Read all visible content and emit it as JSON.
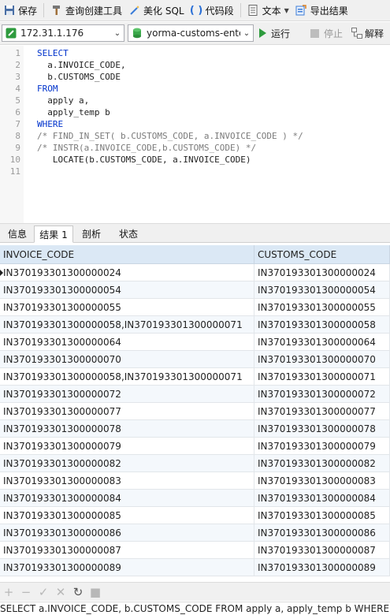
{
  "toolbar": {
    "save": "保存",
    "query_builder": "查询创建工具",
    "beautify": "美化 SQL",
    "snippet": "代码段",
    "text": "文本",
    "export": "导出结果"
  },
  "connection": {
    "host": "172.31.1.176",
    "database": "yorma-customs-ente",
    "run": "运行",
    "stop": "停止",
    "explain": "解释"
  },
  "editor": {
    "line_numbers": [
      "1",
      "2",
      "3",
      "4",
      "5",
      "6",
      "7",
      "8",
      "9",
      "10",
      "11"
    ],
    "lines": [
      "SELECT",
      "  a.INVOICE_CODE,",
      "  b.CUSTOMS_CODE",
      "FROM",
      "  apply a,",
      "  apply_temp b",
      "WHERE",
      "/* FIND_IN_SET( b.CUSTOMS_CODE, a.INVOICE_CODE ) */",
      "/* INSTR(a.INVOICE_CODE,b.CUSTOMS_CODE) */",
      "   LOCATE(b.CUSTOMS_CODE, a.INVOICE_CODE)",
      ""
    ]
  },
  "result_tabs": [
    "信息",
    "结果 1",
    "剖析",
    "状态"
  ],
  "grid": {
    "columns": [
      "INVOICE_CODE",
      "CUSTOMS_CODE"
    ],
    "rows": [
      [
        "IN370193301300000024",
        "IN370193301300000024"
      ],
      [
        "IN370193301300000054",
        "IN370193301300000054"
      ],
      [
        "IN370193301300000055",
        "IN370193301300000055"
      ],
      [
        "IN370193301300000058,IN370193301300000071",
        "IN370193301300000058"
      ],
      [
        "IN370193301300000064",
        "IN370193301300000064"
      ],
      [
        "IN370193301300000070",
        "IN370193301300000070"
      ],
      [
        "IN370193301300000058,IN370193301300000071",
        "IN370193301300000071"
      ],
      [
        "IN370193301300000072",
        "IN370193301300000072"
      ],
      [
        "IN370193301300000077",
        "IN370193301300000077"
      ],
      [
        "IN370193301300000078",
        "IN370193301300000078"
      ],
      [
        "IN370193301300000079",
        "IN370193301300000079"
      ],
      [
        "IN370193301300000082",
        "IN370193301300000082"
      ],
      [
        "IN370193301300000083",
        "IN370193301300000083"
      ],
      [
        "IN370193301300000084",
        "IN370193301300000084"
      ],
      [
        "IN370193301300000085",
        "IN370193301300000085"
      ],
      [
        "IN370193301300000086",
        "IN370193301300000086"
      ],
      [
        "IN370193301300000087",
        "IN370193301300000087"
      ],
      [
        "IN370193301300000089",
        "IN370193301300000089"
      ]
    ]
  },
  "status": "SELECT   a.INVOICE_CODE,   b.CUSTOMS_CODE  FROM   apply a,   apply_temp b  WHERE"
}
